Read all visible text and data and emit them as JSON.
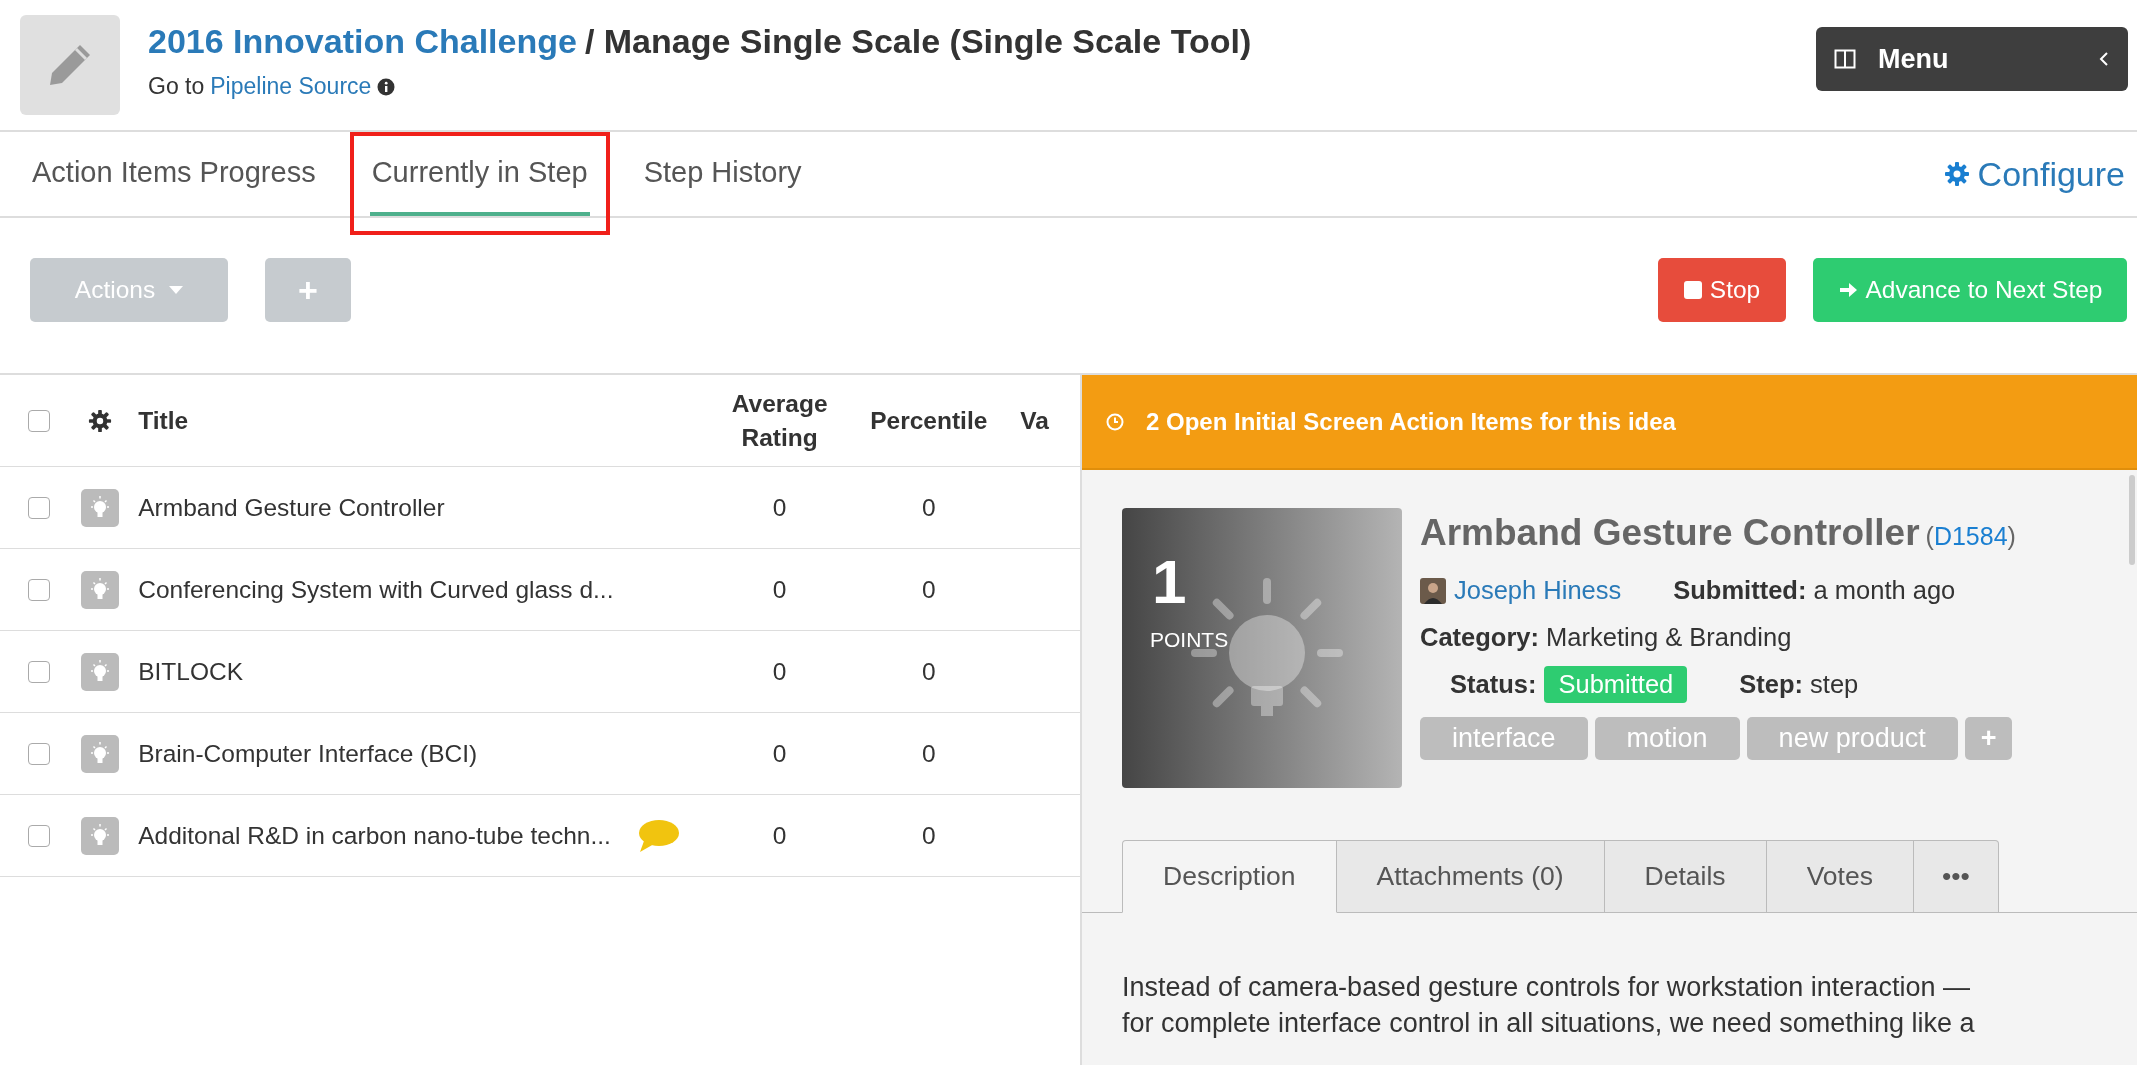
{
  "header": {
    "title_link": "2016 Innovation Challenge",
    "title_rest": "/ Manage Single Scale (Single Scale Tool)",
    "goto_label": "Go to",
    "goto_link": "Pipeline Source"
  },
  "menu_button": {
    "label": "Menu"
  },
  "tabs": [
    {
      "label": "Action Items Progress",
      "selected": false,
      "highlighted": false
    },
    {
      "label": "Currently in Step",
      "selected": true,
      "highlighted": true
    },
    {
      "label": "Step History",
      "selected": false,
      "highlighted": false
    }
  ],
  "configure": {
    "label": "Configure"
  },
  "toolbar": {
    "actions": "Actions",
    "add": "+",
    "stop": "Stop",
    "advance": "Advance to Next Step"
  },
  "table": {
    "header_checked": false,
    "columns": [
      "Title",
      "Average Rating",
      "Percentile",
      "Va"
    ],
    "rows": [
      {
        "title": "Armband Gesture Controller",
        "checked": false,
        "average_rating": "0",
        "percentile": "0",
        "has_comment": false
      },
      {
        "title": "Conferencing System with Curved glass d...",
        "checked": false,
        "average_rating": "0",
        "percentile": "0",
        "has_comment": false
      },
      {
        "title": "BITLOCK",
        "checked": false,
        "average_rating": "0",
        "percentile": "0",
        "has_comment": false
      },
      {
        "title": "Brain-Computer Interface (BCI)",
        "checked": false,
        "average_rating": "0",
        "percentile": "0",
        "has_comment": false
      },
      {
        "title": "Additonal R&D in carbon nano-tube techn...",
        "checked": false,
        "average_rating": "0",
        "percentile": "0",
        "has_comment": true
      }
    ]
  },
  "detail": {
    "alert": "2 Open Initial Screen Action Items for this idea",
    "points": "1",
    "points_label": "POINTS",
    "title": "Armband Gesture Controller",
    "id_prefix": "(",
    "id": "D1584",
    "id_suffix": ")",
    "author": "Joseph Hiness",
    "submitted_label": "Submitted:",
    "submitted": "a month ago",
    "category_label": "Category:",
    "category": "Marketing & Branding",
    "status_label": "Status:",
    "status": "Submitted",
    "step_label": "Step:",
    "step": "step",
    "tags": [
      "interface",
      "motion",
      "new product"
    ],
    "add_tag": "+",
    "tabs": [
      {
        "label": "Description",
        "selected": true
      },
      {
        "label": "Attachments (0)",
        "selected": false
      },
      {
        "label": "Details",
        "selected": false
      },
      {
        "label": "Votes",
        "selected": false
      },
      {
        "label": "•••",
        "selected": false
      }
    ],
    "description_lines": [
      "Instead of camera-based gesture controls for workstation interaction —",
      "for complete interface control in all situations, we need something like a"
    ]
  }
}
